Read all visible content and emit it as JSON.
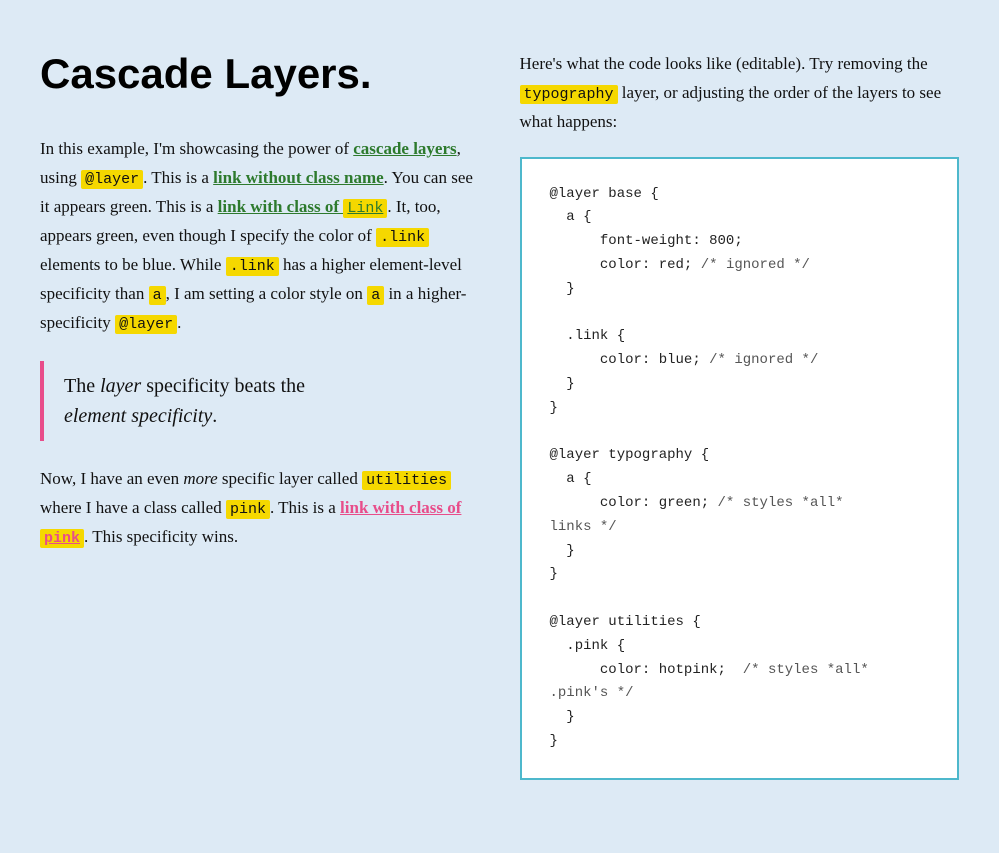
{
  "page": {
    "background": "#ddeaf5"
  },
  "left": {
    "title": "Cascade Layers.",
    "intro": "In this example, I'm showcasing the power of",
    "cascade_layers_text": "cascade layers",
    "using_text": ", using",
    "layer_badge": "@layer",
    "this_is_a": ". This is a",
    "link_no_class": "link without class name",
    "you_can": ". You can see it appears green. This is a",
    "link_with_class": "link with class of",
    "link_badge": "link",
    "it_too": ". It, too, appears green, even though I specify the color of",
    "link_badge2": ".link",
    "elements_blue": "elements to be blue. While",
    "link_badge3": ".link",
    "has_a": "has a higher element-level specificity than",
    "a_badge": "a",
    "i_am": ", I am setting a color style on",
    "a_badge2": "a",
    "in_higher": "in a higher-specificity",
    "layer_badge2": "@layer",
    "period": ".",
    "blockquote_line1": "The",
    "blockquote_em1": "layer",
    "blockquote_mid": "specificity beats the",
    "blockquote_line2": "",
    "blockquote_em2": "element specificity",
    "blockquote_period": ".",
    "now_text": "Now, I have an even",
    "more_em": "more",
    "specific_text": "specific layer called",
    "utilities_badge": "utilities",
    "where_text": "where I have a class called",
    "pink_badge": "pink",
    "this_is_a2": ". This is a",
    "link_pink_text": "link with class of",
    "pink_highlight": "pink",
    "this_spec": ". This specificity wins."
  },
  "right": {
    "desc1": "Here's what the code looks like (editable). Try removing the",
    "typography_badge": "typography",
    "desc2": "layer, or adjusting the order of the layers to see what happens:",
    "code": "@layer base {\n  a {\n      font-weight: 800;\n      color: red; /* ignored */\n  }\n\n  .link {\n      color: blue; /* ignored */\n  }\n}\n\n@layer typography {\n  a {\n      color: green; /* styles *all*\nlinks */\n  }\n}\n\n@layer utilities {\n  .pink {\n      color: hotpink;  /* styles *all*\n.pink's */\n  }\n}"
  }
}
